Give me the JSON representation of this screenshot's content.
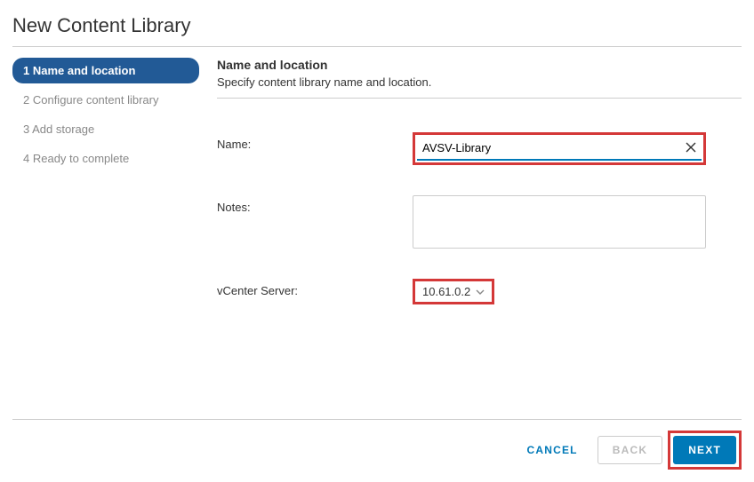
{
  "dialog": {
    "title": "New Content Library"
  },
  "steps": [
    {
      "label": "1 Name and location"
    },
    {
      "label": "2 Configure content library"
    },
    {
      "label": "3 Add storage"
    },
    {
      "label": "4 Ready to complete"
    }
  ],
  "section": {
    "heading": "Name and location",
    "subheading": "Specify content library name and location."
  },
  "form": {
    "name_label": "Name:",
    "name_value": "AVSV-Library",
    "notes_label": "Notes:",
    "notes_value": "",
    "server_label": "vCenter Server:",
    "server_value": "10.61.0.2"
  },
  "buttons": {
    "cancel": "CANCEL",
    "back": "BACK",
    "next": "NEXT"
  }
}
